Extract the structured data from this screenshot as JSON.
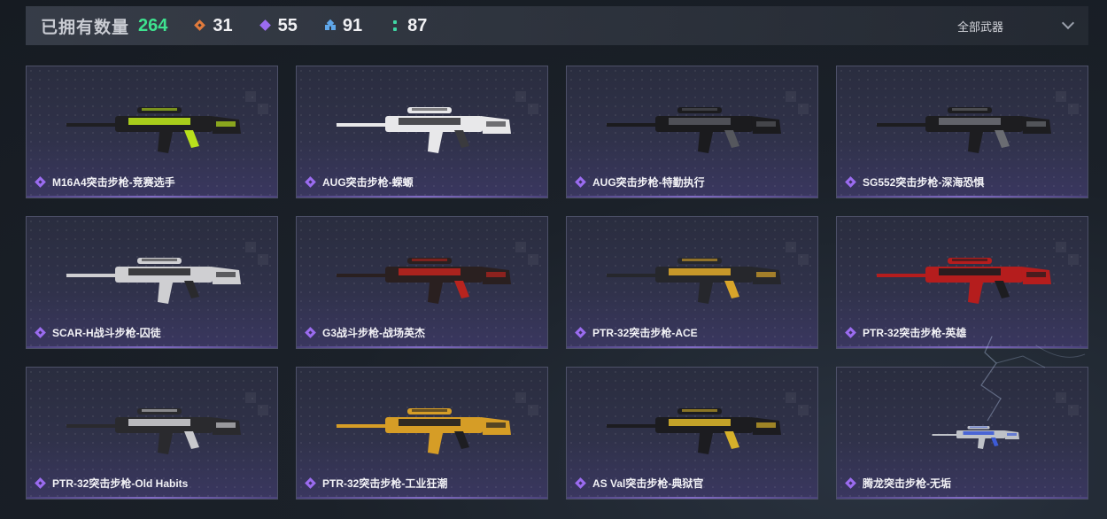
{
  "header": {
    "owned_label": "已拥有数量",
    "owned_count": "264",
    "stats": [
      {
        "icon": "orange-rarity-icon",
        "color": "#e07a3c",
        "value": "31"
      },
      {
        "icon": "purple-rarity-icon",
        "color": "#9b6cf0",
        "value": "55"
      },
      {
        "icon": "blue-rarity-icon",
        "color": "#5fa7ea",
        "value": "91"
      },
      {
        "icon": "green-rarity-icon",
        "color": "#3fd6a3",
        "value": "87"
      }
    ],
    "filter": {
      "selected": "全部武器",
      "icon": "chevron-down-icon"
    }
  },
  "weapons": [
    {
      "name": "M16A4突击步枪-竞赛选手",
      "rarity": "purple",
      "skin_colors": [
        "#1f1f22",
        "#b8e01c"
      ]
    },
    {
      "name": "AUG突击步枪-蝾螈",
      "rarity": "purple",
      "skin_colors": [
        "#e8e8ea",
        "#3a3a3e"
      ]
    },
    {
      "name": "AUG突击步枪-特勤执行",
      "rarity": "purple",
      "skin_colors": [
        "#1b1b1e",
        "#55575d"
      ]
    },
    {
      "name": "SG552突击步枪-深海恐惧",
      "rarity": "purple",
      "skin_colors": [
        "#1d1d20",
        "#6a6c72"
      ]
    },
    {
      "name": "SCAR-H战斗步枪-囚徒",
      "rarity": "purple",
      "skin_colors": [
        "#cfcfd2",
        "#2a2a2d"
      ]
    },
    {
      "name": "G3战斗步枪-战场英杰",
      "rarity": "purple",
      "skin_colors": [
        "#2a2020",
        "#b8241e"
      ]
    },
    {
      "name": "PTR-32突击步枪-ACE",
      "rarity": "purple",
      "skin_colors": [
        "#26272c",
        "#d9a52a"
      ]
    },
    {
      "name": "PTR-32突击步枪-英雄",
      "rarity": "purple",
      "skin_colors": [
        "#b51d1d",
        "#1d1d20"
      ]
    },
    {
      "name": "PTR-32突击步枪-Old Habits",
      "rarity": "purple",
      "skin_colors": [
        "#2a2a2e",
        "#c9c9cd"
      ]
    },
    {
      "name": "PTR-32突击步枪-工业狂潮",
      "rarity": "purple",
      "skin_colors": [
        "#d69d26",
        "#1e1e22"
      ]
    },
    {
      "name": "AS Val突击步枪-典狱官",
      "rarity": "purple",
      "skin_colors": [
        "#1c1c20",
        "#d6b12a"
      ]
    },
    {
      "name": "腾龙突击步枪-无垢",
      "rarity": "purple",
      "skin_colors": [
        "#bfc2c8",
        "#3d5bd6"
      ]
    }
  ]
}
